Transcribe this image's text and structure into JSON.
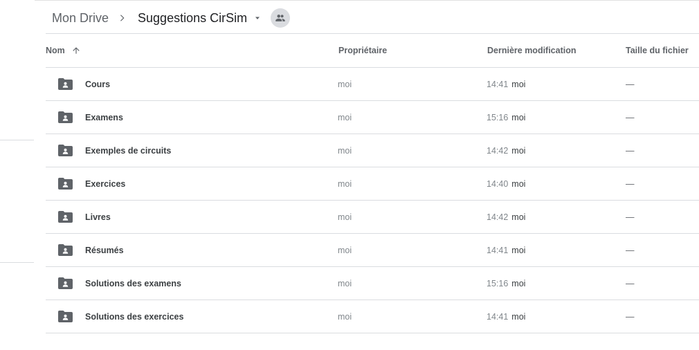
{
  "breadcrumb": {
    "root": "Mon Drive",
    "current": "Suggestions CirSim",
    "shared_icon": "people-icon"
  },
  "columns": {
    "name": "Nom",
    "owner": "Propriétaire",
    "modified": "Dernière modification",
    "size": "Taille du fichier",
    "sort_icon": "arrow-up-icon"
  },
  "rows": [
    {
      "name": "Cours",
      "owner": "moi",
      "time": "14:41",
      "by": "moi",
      "size": "—"
    },
    {
      "name": "Examens",
      "owner": "moi",
      "time": "15:16",
      "by": "moi",
      "size": "—"
    },
    {
      "name": "Exemples de circuits",
      "owner": "moi",
      "time": "14:42",
      "by": "moi",
      "size": "—"
    },
    {
      "name": "Exercices",
      "owner": "moi",
      "time": "14:40",
      "by": "moi",
      "size": "—"
    },
    {
      "name": "Livres",
      "owner": "moi",
      "time": "14:42",
      "by": "moi",
      "size": "—"
    },
    {
      "name": "Résumés",
      "owner": "moi",
      "time": "14:41",
      "by": "moi",
      "size": "—"
    },
    {
      "name": "Solutions des examens",
      "owner": "moi",
      "time": "15:16",
      "by": "moi",
      "size": "—"
    },
    {
      "name": "Solutions des exercices",
      "owner": "moi",
      "time": "14:41",
      "by": "moi",
      "size": "—"
    }
  ],
  "colors": {
    "divider": "#dadce0",
    "folder_icon": "#5f6368",
    "header_text": "#5f6368",
    "muted_text": "#80868b"
  }
}
